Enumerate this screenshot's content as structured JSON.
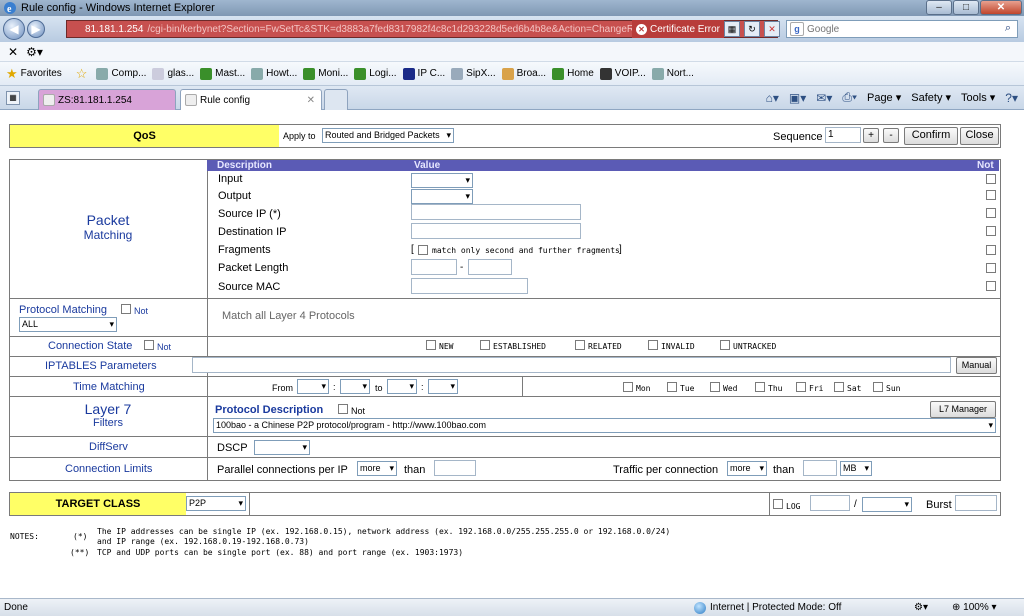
{
  "window": {
    "title": "Rule config - Windows Internet Explorer"
  },
  "browser": {
    "address_host": "81.181.1.254",
    "address_rest": "/cgi-bin/kerbynet?Section=FwSetTc&STK=d3883a7fed8317982f4c8c1d293228d5ed6b4b8e&Action=ChangeRul",
    "cert_error": "Certificate Error",
    "search_placeholder": "Google",
    "favorites": [
      {
        "label": "Comp..."
      },
      {
        "label": "glas..."
      },
      {
        "label": "Mast..."
      },
      {
        "label": "Howt..."
      },
      {
        "label": "Moni..."
      },
      {
        "label": "Logi..."
      },
      {
        "label": "IP C..."
      },
      {
        "label": "SipX..."
      },
      {
        "label": "Broa..."
      },
      {
        "label": "Home"
      },
      {
        "label": "VOIP..."
      },
      {
        "label": "Nort..."
      }
    ],
    "favorites_label": "Favorites",
    "tabs": [
      {
        "label": "ZS:81.181.1.254"
      },
      {
        "label": "Rule config"
      }
    ],
    "tools": {
      "page": "Page",
      "safety": "Safety",
      "tools": "Tools"
    },
    "status": {
      "left": "Done",
      "zone": "Internet | Protected Mode: Off",
      "zoom": "100%"
    }
  },
  "qos": {
    "title": "QoS",
    "apply_to_label": "Apply to",
    "apply_to_value": "Routed and Bridged Packets",
    "sequence_label": "Sequence",
    "sequence_value": "1",
    "plus": "+",
    "minus": "-",
    "confirm": "Confirm",
    "close": "Close"
  },
  "packet": {
    "title": "Packet",
    "subtitle": "Matching",
    "col_desc": "Description",
    "col_value": "Value",
    "col_not": "Not",
    "rows": [
      {
        "label": "Input"
      },
      {
        "label": "Output"
      },
      {
        "label": "Source IP (*)"
      },
      {
        "label": "Destination IP"
      },
      {
        "label": "Fragments"
      },
      {
        "label": "Packet Length"
      },
      {
        "label": "Source MAC"
      }
    ],
    "fragments_open": "[",
    "fragments_text": "match only second and further fragments",
    "fragments_close": "]",
    "length_sep": "-"
  },
  "protocol": {
    "label": "Protocol Matching",
    "not": "Not",
    "value": "ALL",
    "match_all": "Match all Layer 4 Protocols"
  },
  "connstate": {
    "label": "Connection State",
    "not": "Not",
    "options": [
      "NEW",
      "ESTABLISHED",
      "RELATED",
      "INVALID",
      "UNTRACKED"
    ]
  },
  "iptables": {
    "label": "IPTABLES Parameters",
    "manual": "Manual"
  },
  "time": {
    "label": "Time Matching",
    "from": "From",
    "to": "to",
    "colon": ":",
    "days": [
      "Mon",
      "Tue",
      "Wed",
      "Thu",
      "Fri",
      "Sat",
      "Sun"
    ]
  },
  "l7": {
    "title": "Layer 7",
    "subtitle": "Filters",
    "proto_desc": "Protocol Description",
    "not": "Not",
    "manager": "L7 Manager",
    "value": "100bao - a Chinese P2P protocol/program - http://www.100bao.com"
  },
  "diffserv": {
    "label": "DiffServ",
    "dscp": "DSCP"
  },
  "connlimits": {
    "label": "Connection Limits",
    "parallel": "Parallel connections per IP",
    "more1": "more",
    "than1": "than",
    "traffic": "Traffic per connection",
    "more2": "more",
    "than2": "than",
    "unit": "MB"
  },
  "target": {
    "label": "TARGET CLASS",
    "value": "P2P",
    "log": "LOG",
    "slash": "/",
    "burst": "Burst"
  },
  "notes": {
    "label": "NOTES:",
    "m1": "(*)",
    "n1a": "The IP addresses can be single IP (ex. 192.168.0.15), network address (ex. 192.168.0.0/255.255.255.0 or 192.168.0.0/24)",
    "n1b": "and IP range (ex. 192.168.0.19-192.168.0.73)",
    "m2": "(**)",
    "n2": "TCP and UDP ports can be single port (ex. 88) and port range (ex. 1903:1973)"
  }
}
